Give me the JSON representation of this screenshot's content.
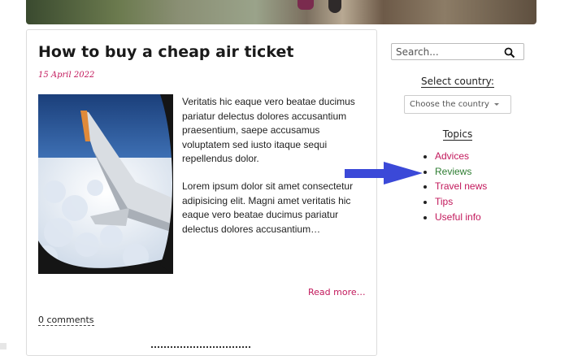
{
  "article": {
    "title": "How to buy a cheap air ticket",
    "date": "15 April 2022",
    "paragraph1": "Veritatis hic eaque vero beatae ducimus pariatur delectus dolores accusantium praesentium, saepe accusamus voluptatem sed iusto itaque sequi repellendus dolor.",
    "paragraph2": "Lorem ipsum dolor sit amet consectetur adipisicing elit. Magni amet veritatis hic eaque vero beatae ducimus pariatur delectus dolores accusantium…",
    "read_more": "Read more…",
    "comments": "0 comments"
  },
  "sidebar": {
    "search_placeholder": "Search...",
    "search_icon": "search-icon",
    "select_label": "Select country:",
    "select_value": "Choose the country",
    "topics_label": "Topics",
    "topics": [
      {
        "label": "Advices",
        "color": "#c2185b"
      },
      {
        "label": "Reviews",
        "color": "#2e7d32"
      },
      {
        "label": "Travel news",
        "color": "#c2185b"
      },
      {
        "label": "Tips",
        "color": "#c2185b"
      },
      {
        "label": "Useful info",
        "color": "#c2185b"
      }
    ]
  },
  "colors": {
    "accent": "#c2185b",
    "highlight": "#2e7d32",
    "arrow": "#3b49d8"
  }
}
